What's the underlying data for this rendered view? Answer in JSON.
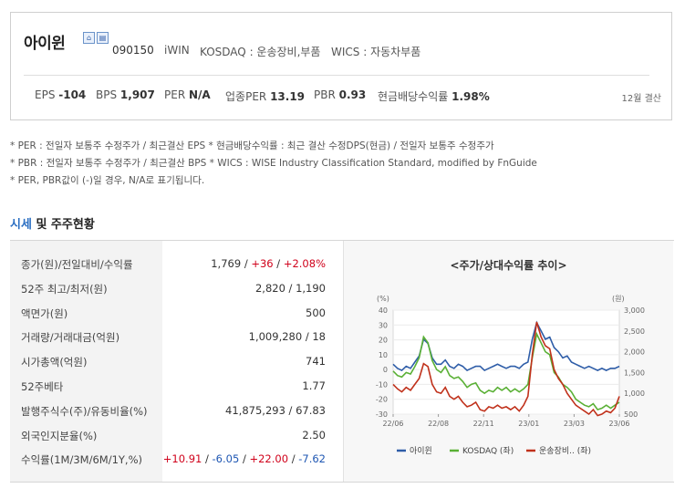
{
  "company": {
    "name": "아이윈",
    "code": "090150",
    "eng_name": "iWIN",
    "market": "KOSDAQ : 운송장비,부품",
    "wics": "WICS : 자동차부품",
    "icon_badges": [
      "home-icon",
      "ir-icon"
    ]
  },
  "stats": [
    {
      "label": "EPS",
      "value": "-104"
    },
    {
      "label": "BPS",
      "value": "1,907"
    },
    {
      "label": "PER",
      "value": "N/A"
    },
    {
      "label": "업종PER",
      "value": "13.19"
    },
    {
      "label": "PBR",
      "value": "0.93"
    },
    {
      "label": "현금배당수익률",
      "value": "1.98%"
    }
  ],
  "settle_month": "12월 결산",
  "notes": [
    "* PER : 전일자 보통주 수정주가 / 최근결산 EPS * 현금배당수익률 : 최근 결산 수정DPS(현금) / 전일자 보통주 수정주가",
    "* PBR : 전일자 보통주 수정주가 / 최근결산 BPS * WICS : WISE Industry Classification Standard, modified by FnGuide",
    "* PER, PBR값이 (-)일 경우, N/A로 표기됩니다."
  ],
  "section": {
    "title_blue": "시세",
    "title_rest": " 및 주주현황"
  },
  "table": [
    {
      "label": "종가(원)/전일대비/수익률",
      "parts": [
        {
          "t": "1,769",
          "c": ""
        },
        {
          "t": " / ",
          "c": ""
        },
        {
          "t": "+36",
          "c": "up"
        },
        {
          "t": " / ",
          "c": ""
        },
        {
          "t": "+2.08%",
          "c": "up"
        }
      ]
    },
    {
      "label": "52주 최고/최저(원)",
      "parts": [
        {
          "t": "2,820 / 1,190",
          "c": ""
        }
      ]
    },
    {
      "label": "액면가(원)",
      "parts": [
        {
          "t": "500",
          "c": ""
        }
      ]
    },
    {
      "label": "거래량/거래대금(억원)",
      "parts": [
        {
          "t": "1,009,280 / 18",
          "c": ""
        }
      ]
    },
    {
      "label": "시가총액(억원)",
      "parts": [
        {
          "t": "741",
          "c": ""
        }
      ]
    },
    {
      "label": "52주베타",
      "parts": [
        {
          "t": "1.77",
          "c": ""
        }
      ]
    },
    {
      "label": "발행주식수(주)/유동비율(%)",
      "parts": [
        {
          "t": "41,875,293 / 67.83",
          "c": ""
        }
      ]
    },
    {
      "label": "외국인지분율(%)",
      "parts": [
        {
          "t": "2.50",
          "c": ""
        }
      ]
    },
    {
      "label": "수익률(1M/3M/6M/1Y,%)",
      "parts": [
        {
          "t": "+10.91",
          "c": "up"
        },
        {
          "t": " / ",
          "c": ""
        },
        {
          "t": "-6.05",
          "c": "down"
        },
        {
          "t": " / ",
          "c": ""
        },
        {
          "t": "+22.00",
          "c": "up"
        },
        {
          "t": " / ",
          "c": ""
        },
        {
          "t": "-7.62",
          "c": "down"
        }
      ]
    }
  ],
  "chart_data": {
    "type": "line",
    "title": "<주가/상대수익률 추이>",
    "left_unit": "(%)",
    "right_unit": "(원)",
    "y_left_ticks": [
      "40",
      "30",
      "20",
      "10",
      "0",
      "-10",
      "-20",
      "-30"
    ],
    "y_right_ticks": [
      "3,000",
      "2,500",
      "2,000",
      "1,500",
      "1,000",
      "500"
    ],
    "x_ticks": [
      "22/06",
      "22/08",
      "22/11",
      "23/01",
      "23/03",
      "23/06"
    ],
    "ylim_left": [
      -30,
      40
    ],
    "ylim_right": [
      500,
      3000
    ],
    "legend_position": "bottom",
    "series": [
      {
        "name": "아이윈",
        "axis": "right",
        "color": "#2e5da8",
        "values": [
          1700,
          1600,
          1550,
          1650,
          1600,
          1750,
          1900,
          2300,
          2200,
          1850,
          1700,
          1700,
          1800,
          1650,
          1600,
          1700,
          1650,
          1550,
          1600,
          1650,
          1650,
          1550,
          1600,
          1650,
          1700,
          1650,
          1600,
          1650,
          1650,
          1600,
          1700,
          1750,
          2300,
          2700,
          2500,
          2300,
          2350,
          2100,
          2000,
          1850,
          1900,
          1750,
          1700,
          1650,
          1600,
          1650,
          1600,
          1550,
          1600,
          1550,
          1600,
          1600,
          1650
        ]
      },
      {
        "name": "KOSDAQ (좌)",
        "axis": "left",
        "color": "#5ab035",
        "values": [
          -1,
          -4,
          -5,
          -2,
          -3,
          2,
          8,
          22,
          18,
          6,
          0,
          -2,
          2,
          -4,
          -6,
          -5,
          -8,
          -12,
          -10,
          -9,
          -14,
          -16,
          -14,
          -15,
          -12,
          -14,
          -12,
          -15,
          -13,
          -15,
          -13,
          -10,
          8,
          24,
          18,
          12,
          10,
          -2,
          -5,
          -10,
          -12,
          -15,
          -20,
          -22,
          -24,
          -25,
          -23,
          -27,
          -26,
          -24,
          -26,
          -24,
          -22
        ]
      },
      {
        "name": "운송장비.. (좌)",
        "axis": "left",
        "color": "#c0311b",
        "values": [
          -10,
          -13,
          -15,
          -12,
          -14,
          -10,
          -6,
          4,
          2,
          -10,
          -15,
          -16,
          -12,
          -18,
          -20,
          -18,
          -22,
          -25,
          -24,
          -22,
          -27,
          -28,
          -25,
          -26,
          -24,
          -26,
          -25,
          -27,
          -25,
          -28,
          -24,
          -18,
          10,
          32,
          22,
          16,
          14,
          0,
          -6,
          -10,
          -16,
          -20,
          -24,
          -26,
          -28,
          -30,
          -27,
          -31,
          -30,
          -28,
          -29,
          -26,
          -18
        ]
      }
    ]
  }
}
